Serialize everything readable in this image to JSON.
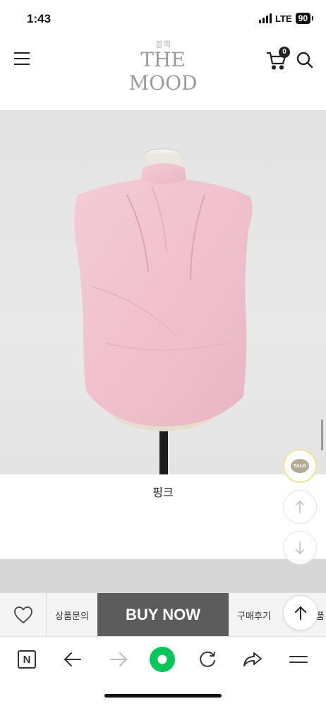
{
  "status_bar": {
    "time": "1:43",
    "network": "LTE",
    "battery": "90"
  },
  "header": {
    "logo_sub": "블랙",
    "logo": "THE MOOD",
    "cart_count": "0",
    "icons": [
      "menu-icon",
      "cart-icon",
      "search-icon"
    ]
  },
  "product": {
    "caption": "핑크",
    "image_colors": {
      "background": "#e6e6e6",
      "garment": "#f2c6d0"
    }
  },
  "floating": {
    "talk_label": "TALK"
  },
  "action_bar": {
    "qna_label": "상품문의",
    "buy_label": "BUY NOW",
    "review_label": "구매후기",
    "partial_label": "품"
  },
  "browser_bar": {
    "naver_label": "N",
    "icons": [
      "naver-icon",
      "back-arrow-icon",
      "forward-arrow-icon",
      "home-icon",
      "refresh-icon",
      "share-icon",
      "menu-lines-icon"
    ],
    "accent": "#03c75a"
  }
}
